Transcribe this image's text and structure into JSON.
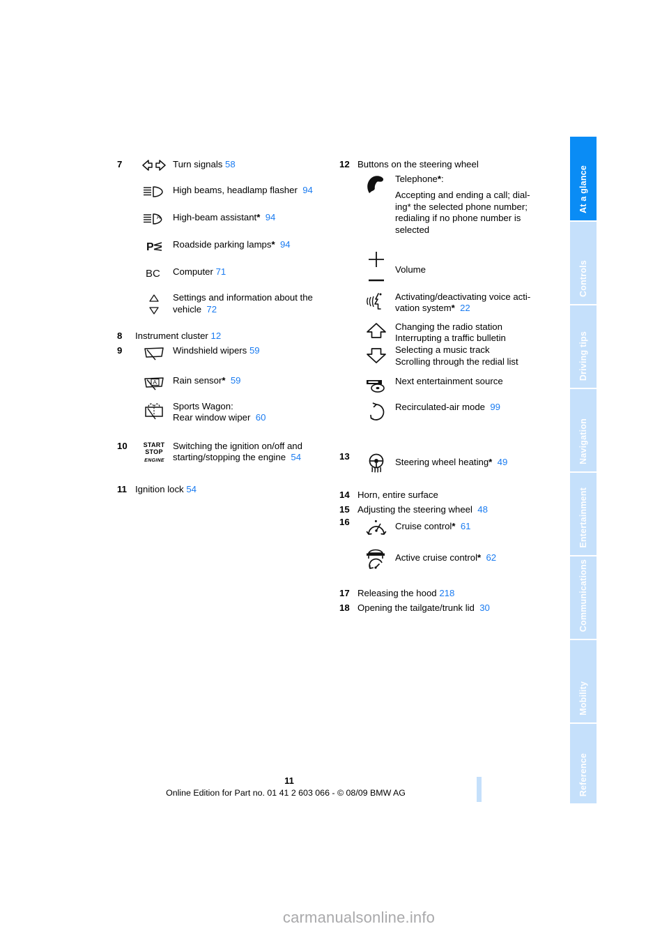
{
  "document": {
    "page_number": "11",
    "online_edition": "Online Edition for Part no. 01 41 2 603 066 - © 08/09 BMW AG",
    "watermark": "carmanualsonline.info",
    "accent_blue": "#1a7bf0",
    "tab_active_color": "#0a8cf5",
    "tab_inactive_color": "#c5e0fb"
  },
  "rail": {
    "tabs": [
      {
        "label": "At a glance",
        "active": true
      },
      {
        "label": "Controls",
        "active": false
      },
      {
        "label": "Driving tips",
        "active": false
      },
      {
        "label": "Navigation",
        "active": false
      },
      {
        "label": "Entertainment",
        "active": false
      },
      {
        "label": "Communications",
        "active": false
      },
      {
        "label": "Mobility",
        "active": false
      },
      {
        "label": "Reference",
        "active": false
      }
    ]
  },
  "left_column": {
    "item7": {
      "number": "7",
      "rows": [
        {
          "icon": "turn-signals-icon",
          "label": "Turn signals",
          "page": "58",
          "star": false
        },
        {
          "icon": "high-beams-icon",
          "label": "High beams, headlamp flasher",
          "page": "94",
          "star": false
        },
        {
          "icon": "high-beam-assistant-icon",
          "label": "High-beam assistant",
          "page": "94",
          "star": true
        },
        {
          "icon": "roadside-parking-lamps-icon",
          "label": "Roadside parking lamps",
          "page": "94",
          "star": true
        },
        {
          "icon": "bc-computer-icon",
          "label": "Computer",
          "page": "71",
          "star": false
        },
        {
          "icon": "up-down-arrows-icon",
          "label_line1": "Settings and information about the",
          "label_line2": "vehicle",
          "page": "72",
          "star": false
        }
      ]
    },
    "item8": {
      "number": "8",
      "label": "Instrument cluster",
      "page": "12"
    },
    "item9": {
      "number": "9",
      "rows": [
        {
          "icon": "windshield-wiper-icon",
          "label": "Windshield wipers",
          "page": "59",
          "star": false
        },
        {
          "icon": "rain-sensor-icon",
          "label": "Rain sensor",
          "page": "59",
          "star": true
        },
        {
          "icon": "rear-window-wiper-icon",
          "label_line1": "Sports Wagon:",
          "label_line2": "Rear window wiper",
          "page": "60",
          "star": false
        }
      ]
    },
    "item10": {
      "number": "10",
      "icon": "start-stop-engine-icon",
      "icon_text": {
        "line1": "START",
        "line2": "STOP",
        "line3": "ENGINE"
      },
      "label_line1": "Switching the ignition on/off and",
      "label_line2": "starting/stopping the engine",
      "page": "54"
    },
    "item11": {
      "number": "11",
      "label": "Ignition lock",
      "page": "54"
    }
  },
  "right_column": {
    "item12": {
      "number": "12",
      "heading": "Buttons on the steering wheel",
      "rows": [
        {
          "icon": "telephone-handset-icon",
          "title": "Telephone",
          "star": true,
          "title_suffix": ":",
          "body_lines": [
            "Accepting and ending a call; dial-",
            "ing* the selected phone number;",
            "redialing if no phone number is",
            "selected"
          ]
        },
        {
          "icon": "volume-plus-minus-icon",
          "label": "Volume",
          "page": "",
          "star": false
        },
        {
          "icon": "voice-activation-icon",
          "label_line1": "Activating/deactivating voice acti-",
          "label_line2": "vation system",
          "page": "22",
          "star": true
        },
        {
          "icon": "up-down-block-arrows-icon",
          "body_lines": [
            "Changing the radio station",
            "Interrupting a traffic bulletin",
            "Selecting a music track",
            "Scrolling through the redial list"
          ]
        },
        {
          "icon": "entertainment-source-icon",
          "label": "Next entertainment source",
          "page": "",
          "star": false
        },
        {
          "icon": "recirculated-air-icon",
          "label": "Recirculated-air mode",
          "page": "99",
          "star": false
        }
      ]
    },
    "item13": {
      "number": "13",
      "icon": "steering-wheel-heating-icon",
      "label": "Steering wheel heating",
      "page": "49",
      "star": true
    },
    "item14": {
      "number": "14",
      "label": "Horn, entire surface",
      "page": ""
    },
    "item15": {
      "number": "15",
      "label": "Adjusting the steering wheel",
      "page": "48"
    },
    "item16": {
      "number": "16",
      "rows": [
        {
          "icon": "cruise-control-icon",
          "label": "Cruise control",
          "page": "61",
          "star": true
        },
        {
          "icon": "active-cruise-control-icon",
          "label": "Active cruise control",
          "page": "62",
          "star": true
        }
      ]
    },
    "item17": {
      "number": "17",
      "label": "Releasing the hood",
      "page": "218"
    },
    "item18": {
      "number": "18",
      "label": "Opening the tailgate/trunk lid",
      "page": "30"
    }
  }
}
